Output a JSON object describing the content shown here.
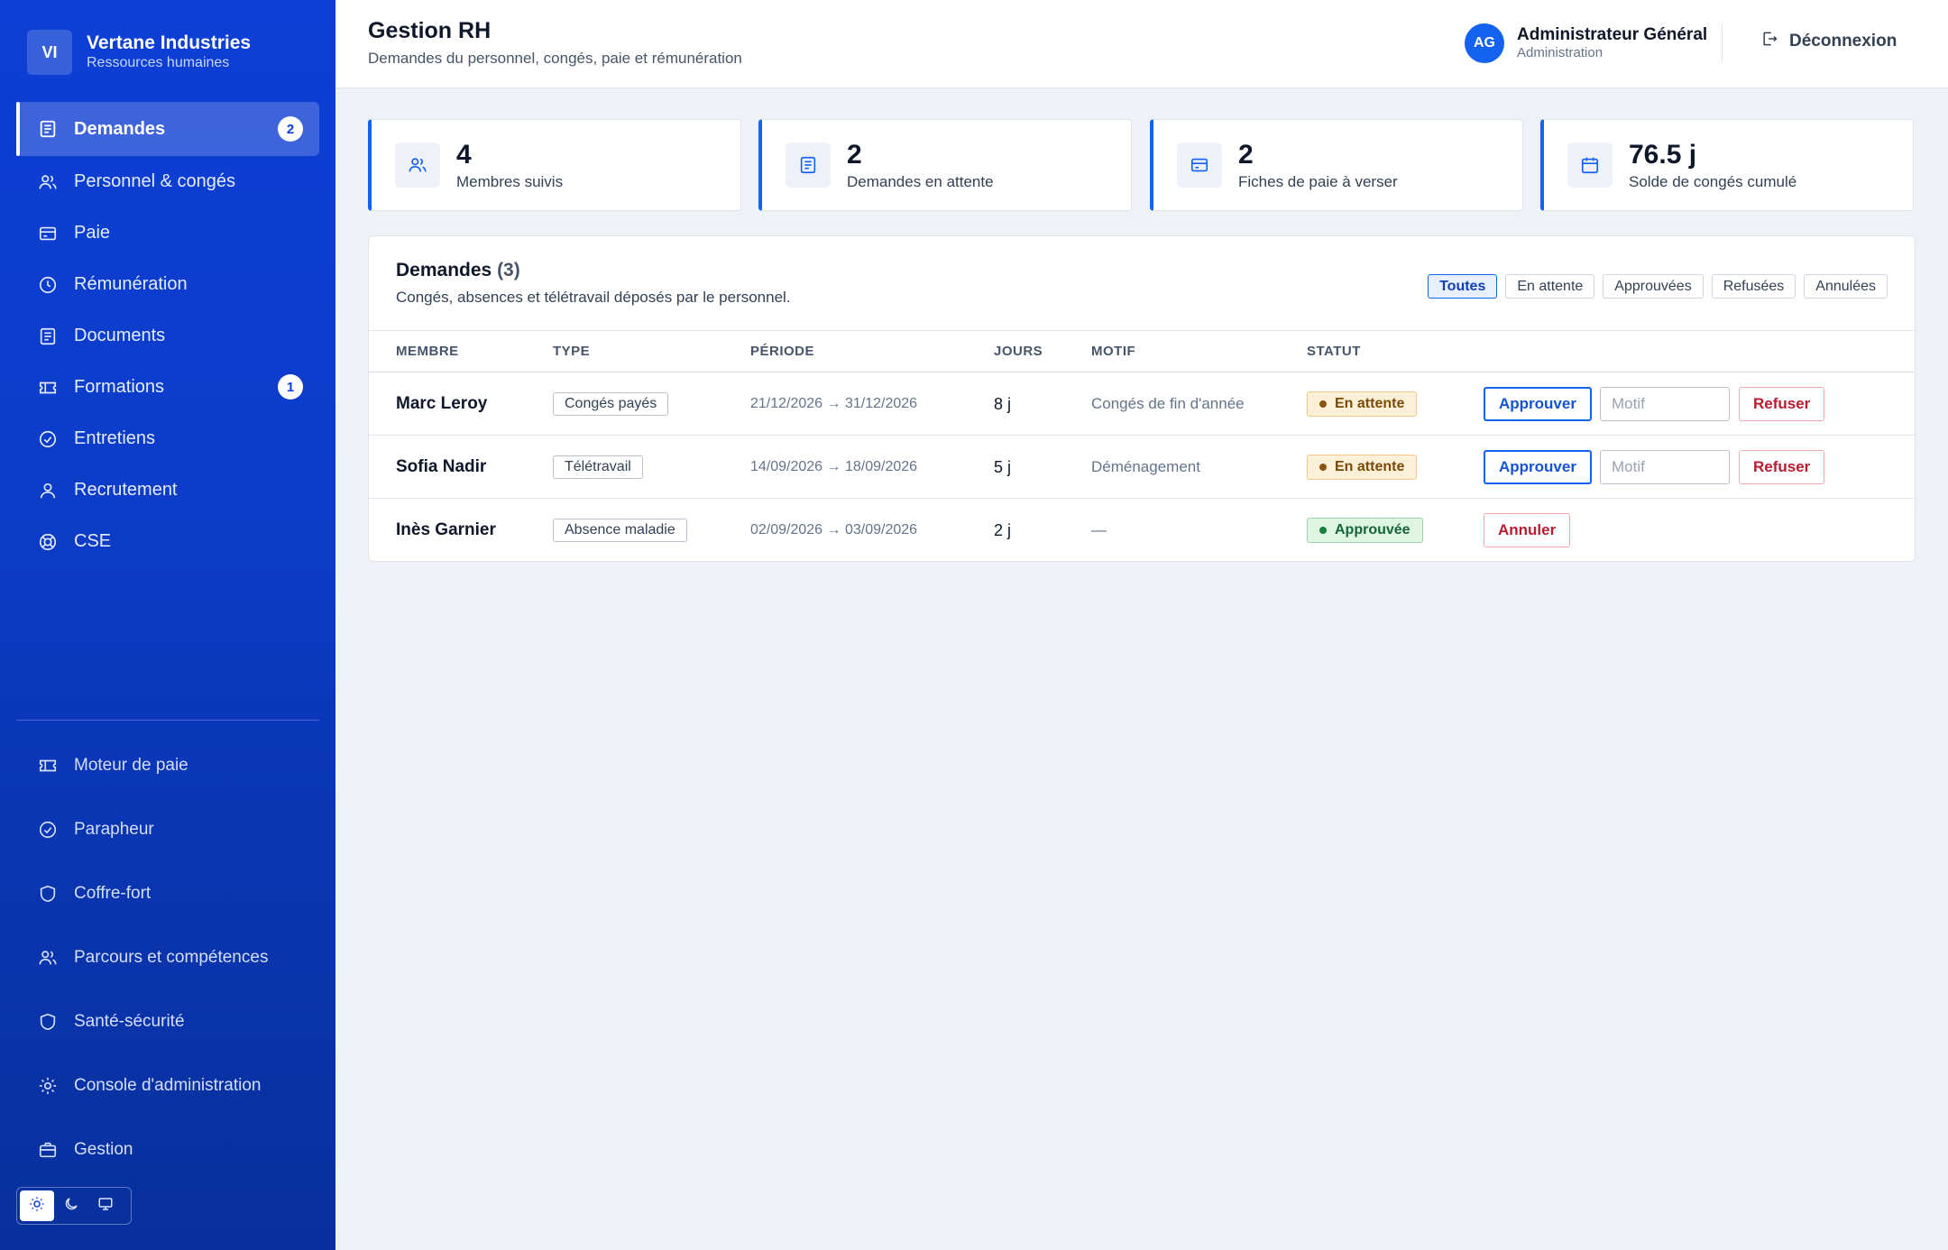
{
  "brand": {
    "initials": "VI",
    "name": "Vertane Industries",
    "subtitle": "Ressources humaines"
  },
  "nav": [
    {
      "label": "Demandes",
      "icon": "list-icon",
      "active": true,
      "badge": "2"
    },
    {
      "label": "Personnel & congés",
      "icon": "users-icon"
    },
    {
      "label": "Paie",
      "icon": "card-icon"
    },
    {
      "label": "Rémunération",
      "icon": "clock-icon"
    },
    {
      "label": "Documents",
      "icon": "document-icon"
    },
    {
      "label": "Formations",
      "icon": "ticket-icon",
      "badge": "1"
    },
    {
      "label": "Entretiens",
      "icon": "check-circle-icon"
    },
    {
      "label": "Recrutement",
      "icon": "user-icon"
    },
    {
      "label": "CSE",
      "icon": "lifebuoy-icon"
    }
  ],
  "nav_secondary": [
    {
      "label": "Moteur de paie",
      "icon": "ticket-icon"
    },
    {
      "label": "Parapheur",
      "icon": "check-circle-icon"
    },
    {
      "label": "Coffre-fort",
      "icon": "shield-icon"
    },
    {
      "label": "Parcours et compétences",
      "icon": "users-icon"
    },
    {
      "label": "Santé-sécurité",
      "icon": "shield-icon"
    },
    {
      "label": "Console d'administration",
      "icon": "gear-icon"
    },
    {
      "label": "Gestion",
      "icon": "briefcase-icon"
    }
  ],
  "header": {
    "title": "Gestion RH",
    "subtitle": "Demandes du personnel, congés, paie et rémunération",
    "user_initials": "AG",
    "user_name": "Administrateur Général",
    "user_role": "Administration",
    "logout_label": "Déconnexion"
  },
  "stats": [
    {
      "value": "4",
      "label": "Membres suivis",
      "icon": "users-icon"
    },
    {
      "value": "2",
      "label": "Demandes en attente",
      "icon": "document-icon"
    },
    {
      "value": "2",
      "label": "Fiches de paie à verser",
      "icon": "card-icon"
    },
    {
      "value": "76.5 j",
      "label": "Solde de congés cumulé",
      "icon": "calendar-icon"
    }
  ],
  "panel": {
    "title": "Demandes",
    "count": "(3)",
    "subtitle": "Congés, absences et télétravail déposés par le personnel.",
    "filters": [
      "Toutes",
      "En attente",
      "Approuvées",
      "Refusées",
      "Annulées"
    ],
    "active_filter": "Toutes",
    "columns": [
      "MEMBRE",
      "TYPE",
      "PÉRIODE",
      "JOURS",
      "MOTIF",
      "STATUT"
    ],
    "rows": [
      {
        "member": "Marc Leroy",
        "type": "Congés payés",
        "period": "21/12/2026 → 31/12/2026",
        "days": "8 j",
        "motif": "Congés de fin d'année",
        "status": "En attente",
        "status_kind": "pending"
      },
      {
        "member": "Sofia Nadir",
        "type": "Télétravail",
        "period": "14/09/2026 → 18/09/2026",
        "days": "5 j",
        "motif": "Déménagement",
        "status": "En attente",
        "status_kind": "pending"
      },
      {
        "member": "Inès Garnier",
        "type": "Absence maladie",
        "period": "02/09/2026 → 03/09/2026",
        "days": "2 j",
        "motif": "—",
        "status": "Approuvée",
        "status_kind": "approved"
      }
    ],
    "approve_label": "Approuver",
    "refuse_label": "Refuser",
    "cancel_label": "Annuler",
    "motif_placeholder": "Motif"
  },
  "colors": {
    "sidebar": "#0d3fd6",
    "accent": "#1463f0",
    "pending": "#fdf0d8",
    "approved": "#def5e3",
    "danger": "#b91c30"
  }
}
